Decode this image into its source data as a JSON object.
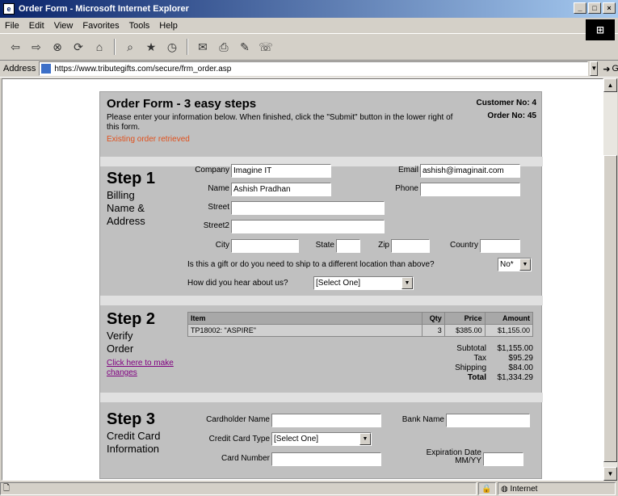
{
  "window": {
    "title": "Order Form - Microsoft Internet Explorer",
    "controls": [
      "_",
      "□",
      "×"
    ]
  },
  "menu": [
    "File",
    "Edit",
    "View",
    "Favorites",
    "Tools",
    "Help"
  ],
  "toolbar": {
    "icons": [
      "back-icon",
      "forward-icon",
      "stop-icon",
      "refresh-icon",
      "home-icon",
      "search-icon",
      "favorites-icon",
      "history-icon",
      "mail-icon",
      "print-icon",
      "edit-icon",
      "discuss-icon"
    ]
  },
  "address": {
    "label": "Address",
    "url": "https://www.tributegifts.com/secure/frm_order.asp",
    "go_label": "Go"
  },
  "form": {
    "title": "Order Form - 3 easy steps",
    "instructions": "Please enter your information below.  When finished, click the \"Submit\" button in the lower right of this form.",
    "status": "Existing order retrieved",
    "customer_no_label": "Customer No:",
    "customer_no": "4",
    "order_no_label": "Order No:",
    "order_no": "45"
  },
  "step1": {
    "title": "Step 1",
    "subtitle_lines": [
      "Billing",
      "Name &",
      "Address"
    ],
    "company_label": "Company",
    "company_value": "Imagine IT",
    "email_label": "Email",
    "email_value": "ashish@imaginait.com",
    "name_label": "Name",
    "name_value": "Ashish Pradhan",
    "phone_label": "Phone",
    "phone_value": "",
    "street_label": "Street",
    "street_value": "",
    "street2_label": "Street2",
    "street2_value": "",
    "city_label": "City",
    "state_label": "State",
    "zip_label": "Zip",
    "country_label": "Country",
    "gift_question": "Is this a gift or do you need to ship to a different location than above?",
    "gift_value": "No*",
    "hear_question": "How did you hear about us?",
    "hear_value": "[Select One]"
  },
  "step2": {
    "title": "Step 2",
    "subtitle_lines": [
      "Verify",
      "Order"
    ],
    "change_link": "Click here to make changes",
    "columns": [
      "Item",
      "Qty",
      "Price",
      "Amount"
    ],
    "rows": [
      {
        "item": "TP18002: \"ASPIRE\"",
        "qty": "3",
        "price": "$385.00",
        "amount": "$1,155.00"
      }
    ],
    "subtotal_label": "Subtotal",
    "subtotal": "$1,155.00",
    "tax_label": "Tax",
    "tax": "$95.29",
    "shipping_label": "Shipping",
    "shipping": "$84.00",
    "total_label": "Total",
    "total": "$1,334.29"
  },
  "step3": {
    "title": "Step 3",
    "subtitle_lines": [
      "Credit Card",
      "Information"
    ],
    "cardholder_label": "Cardholder Name",
    "bank_label": "Bank Name",
    "cardtype_label": "Credit Card Type",
    "cardtype_value": "[Select One]",
    "cardnumber_label": "Card Number",
    "expiration_label_1": "Expiration Date",
    "expiration_label_2": "MM/YY"
  },
  "status": {
    "zone": "Internet"
  }
}
